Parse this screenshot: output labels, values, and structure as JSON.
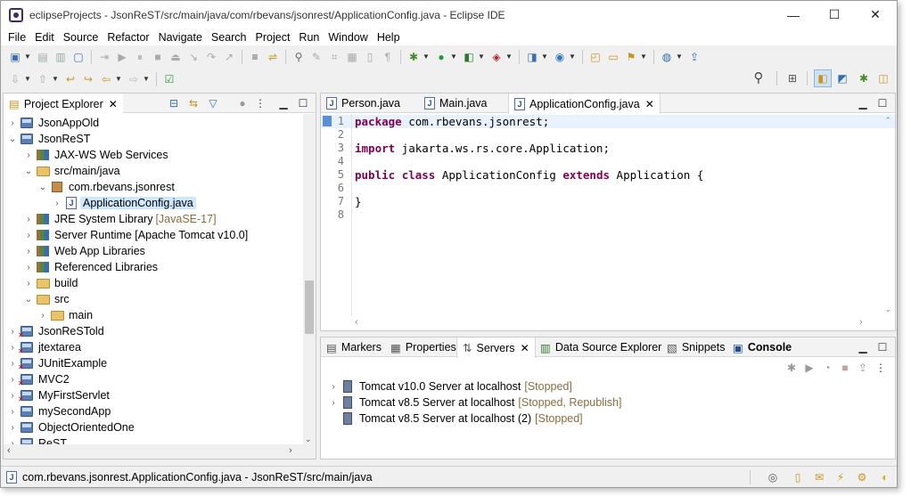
{
  "window": {
    "title": "eclipseProjects - JsonReST/src/main/java/com/rbevans/jsonrest/ApplicationConfig.java - Eclipse IDE",
    "minimize": "—",
    "maximize": "☐",
    "close": "✕"
  },
  "menu": [
    "File",
    "Edit",
    "Source",
    "Refactor",
    "Navigate",
    "Search",
    "Project",
    "Run",
    "Window",
    "Help"
  ],
  "project_explorer": {
    "tab_label": "Project Explorer",
    "items": [
      {
        "label": "JsonAppOld",
        "decoration": "",
        "icon": "project-icon"
      },
      {
        "label": "JsonReST",
        "decoration": "",
        "icon": "project-icon"
      },
      {
        "label": "JAX-WS Web Services",
        "decoration": "",
        "icon": "webservice-icon"
      },
      {
        "label": "src/main/java",
        "decoration": "",
        "icon": "source-folder-icon"
      },
      {
        "label": "com.rbevans.jsonrest",
        "decoration": "",
        "icon": "package-icon"
      },
      {
        "label": "ApplicationConfig.java",
        "decoration": "",
        "icon": "java-file-icon"
      },
      {
        "label": "JRE System Library",
        "decoration": "[JavaSE-17]",
        "icon": "library-icon"
      },
      {
        "label": "Server Runtime [Apache Tomcat v10.0]",
        "decoration": "",
        "icon": "library-icon"
      },
      {
        "label": "Web App Libraries",
        "decoration": "",
        "icon": "library-icon"
      },
      {
        "label": "Referenced Libraries",
        "decoration": "",
        "icon": "library-icon"
      },
      {
        "label": "build",
        "decoration": "",
        "icon": "folder-icon"
      },
      {
        "label": "src",
        "decoration": "",
        "icon": "folder-icon"
      },
      {
        "label": "main",
        "decoration": "",
        "icon": "folder-icon"
      },
      {
        "label": "JsonReSTold",
        "decoration": "",
        "icon": "project-error-icon"
      },
      {
        "label": "jtextarea",
        "decoration": "",
        "icon": "project-error-icon"
      },
      {
        "label": "JUnitExample",
        "decoration": "",
        "icon": "project-error-icon"
      },
      {
        "label": "MVC2",
        "decoration": "",
        "icon": "project-error-icon"
      },
      {
        "label": "MyFirstServlet",
        "decoration": "",
        "icon": "project-error-icon"
      },
      {
        "label": "mySecondApp",
        "decoration": "",
        "icon": "project-icon"
      },
      {
        "label": "ObjectOrientedOne",
        "decoration": "",
        "icon": "project-icon"
      },
      {
        "label": "ReST",
        "decoration": "",
        "icon": "project-icon"
      }
    ]
  },
  "editor": {
    "tabs": [
      "Person.java",
      "Main.java",
      "ApplicationConfig.java"
    ],
    "active_tab": "ApplicationConfig.java",
    "line_numbers": [
      "1",
      "2",
      "3",
      "4",
      "5",
      "6",
      "7",
      "8"
    ],
    "code": {
      "l1_kw": "package",
      "l1_rest": " com.rbevans.jsonrest;",
      "l3_kw": "import",
      "l3_rest": " jakarta.ws.rs.core.Application;",
      "l5_kw1": "public",
      "l5_kw2": "class",
      "l5_mid": " ApplicationConfig ",
      "l5_kw3": "extends",
      "l5_rest": " Application {",
      "l7": "}"
    }
  },
  "bottom_panel": {
    "tabs": [
      "Markers",
      "Properties",
      "Servers",
      "Data Source Explorer",
      "Snippets",
      "Console"
    ],
    "servers": [
      {
        "name": "Tomcat v10.0 Server at localhost",
        "state": "[Stopped]"
      },
      {
        "name": "Tomcat v8.5 Server at localhost",
        "state": "[Stopped, Republish]"
      },
      {
        "name": "Tomcat v8.5 Server at localhost (2)",
        "state": "[Stopped]"
      }
    ]
  },
  "status_bar": {
    "text": "com.rbevans.jsonrest.ApplicationConfig.java - JsonReST/src/main/java"
  },
  "colors": {
    "keyword": "#7f0055",
    "selection": "#cde8ff",
    "decoration": "#8a6d3b"
  }
}
